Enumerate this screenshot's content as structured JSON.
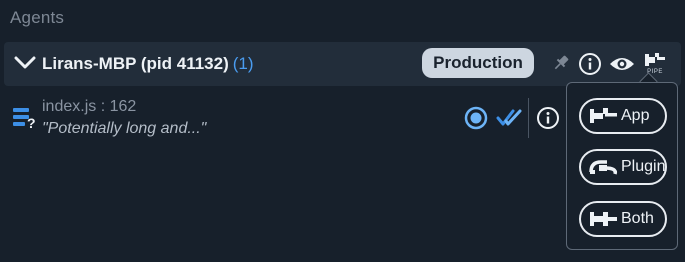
{
  "section": {
    "title": "Agents"
  },
  "agent": {
    "name": "Lirans-MBP (pid 41132)",
    "count": "(1)",
    "environment": "Production",
    "pipe_label": "PIPE"
  },
  "message": {
    "file": "index.js : 162",
    "preview": "\"Potentially long and...\""
  },
  "pipe_menu": {
    "items": [
      {
        "label": "App",
        "icon": "pipe-app-icon"
      },
      {
        "label": "Plugin",
        "icon": "pipe-plugin-icon"
      },
      {
        "label": "Both",
        "icon": "pipe-both-icon"
      }
    ]
  },
  "colors": {
    "background": "#17202b",
    "row_background": "#222d3a",
    "accent_blue": "#4a9cf0",
    "badge_bg": "#cdd6e0"
  },
  "icons": {
    "chevron": "chevron-down-icon",
    "pin": "pin-icon",
    "info": "info-icon",
    "eye": "eye-icon",
    "pipe": "pipe-icon",
    "message": "message-stack-icon",
    "radio": "radio-selected-icon",
    "checks": "double-check-icon"
  }
}
